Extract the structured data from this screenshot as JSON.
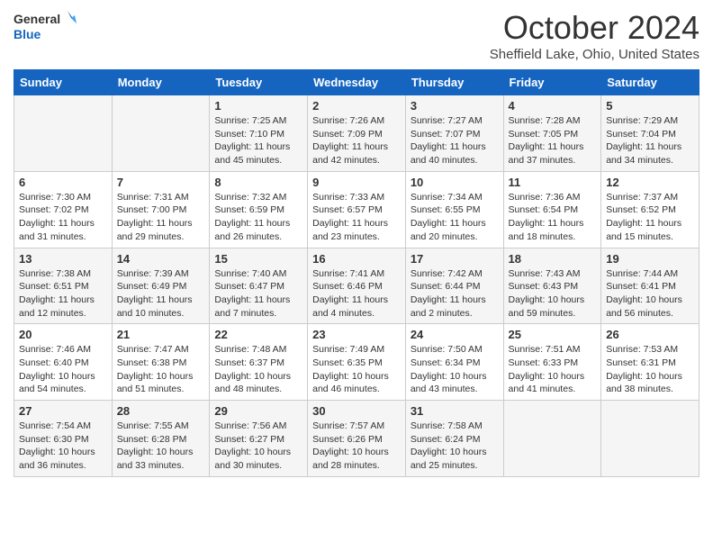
{
  "logo": {
    "line1": "General",
    "line2": "Blue"
  },
  "title": "October 2024",
  "location": "Sheffield Lake, Ohio, United States",
  "days_of_week": [
    "Sunday",
    "Monday",
    "Tuesday",
    "Wednesday",
    "Thursday",
    "Friday",
    "Saturday"
  ],
  "weeks": [
    [
      {
        "day": "",
        "info": ""
      },
      {
        "day": "",
        "info": ""
      },
      {
        "day": "1",
        "info": "Sunrise: 7:25 AM\nSunset: 7:10 PM\nDaylight: 11 hours and 45 minutes."
      },
      {
        "day": "2",
        "info": "Sunrise: 7:26 AM\nSunset: 7:09 PM\nDaylight: 11 hours and 42 minutes."
      },
      {
        "day": "3",
        "info": "Sunrise: 7:27 AM\nSunset: 7:07 PM\nDaylight: 11 hours and 40 minutes."
      },
      {
        "day": "4",
        "info": "Sunrise: 7:28 AM\nSunset: 7:05 PM\nDaylight: 11 hours and 37 minutes."
      },
      {
        "day": "5",
        "info": "Sunrise: 7:29 AM\nSunset: 7:04 PM\nDaylight: 11 hours and 34 minutes."
      }
    ],
    [
      {
        "day": "6",
        "info": "Sunrise: 7:30 AM\nSunset: 7:02 PM\nDaylight: 11 hours and 31 minutes."
      },
      {
        "day": "7",
        "info": "Sunrise: 7:31 AM\nSunset: 7:00 PM\nDaylight: 11 hours and 29 minutes."
      },
      {
        "day": "8",
        "info": "Sunrise: 7:32 AM\nSunset: 6:59 PM\nDaylight: 11 hours and 26 minutes."
      },
      {
        "day": "9",
        "info": "Sunrise: 7:33 AM\nSunset: 6:57 PM\nDaylight: 11 hours and 23 minutes."
      },
      {
        "day": "10",
        "info": "Sunrise: 7:34 AM\nSunset: 6:55 PM\nDaylight: 11 hours and 20 minutes."
      },
      {
        "day": "11",
        "info": "Sunrise: 7:36 AM\nSunset: 6:54 PM\nDaylight: 11 hours and 18 minutes."
      },
      {
        "day": "12",
        "info": "Sunrise: 7:37 AM\nSunset: 6:52 PM\nDaylight: 11 hours and 15 minutes."
      }
    ],
    [
      {
        "day": "13",
        "info": "Sunrise: 7:38 AM\nSunset: 6:51 PM\nDaylight: 11 hours and 12 minutes."
      },
      {
        "day": "14",
        "info": "Sunrise: 7:39 AM\nSunset: 6:49 PM\nDaylight: 11 hours and 10 minutes."
      },
      {
        "day": "15",
        "info": "Sunrise: 7:40 AM\nSunset: 6:47 PM\nDaylight: 11 hours and 7 minutes."
      },
      {
        "day": "16",
        "info": "Sunrise: 7:41 AM\nSunset: 6:46 PM\nDaylight: 11 hours and 4 minutes."
      },
      {
        "day": "17",
        "info": "Sunrise: 7:42 AM\nSunset: 6:44 PM\nDaylight: 11 hours and 2 minutes."
      },
      {
        "day": "18",
        "info": "Sunrise: 7:43 AM\nSunset: 6:43 PM\nDaylight: 10 hours and 59 minutes."
      },
      {
        "day": "19",
        "info": "Sunrise: 7:44 AM\nSunset: 6:41 PM\nDaylight: 10 hours and 56 minutes."
      }
    ],
    [
      {
        "day": "20",
        "info": "Sunrise: 7:46 AM\nSunset: 6:40 PM\nDaylight: 10 hours and 54 minutes."
      },
      {
        "day": "21",
        "info": "Sunrise: 7:47 AM\nSunset: 6:38 PM\nDaylight: 10 hours and 51 minutes."
      },
      {
        "day": "22",
        "info": "Sunrise: 7:48 AM\nSunset: 6:37 PM\nDaylight: 10 hours and 48 minutes."
      },
      {
        "day": "23",
        "info": "Sunrise: 7:49 AM\nSunset: 6:35 PM\nDaylight: 10 hours and 46 minutes."
      },
      {
        "day": "24",
        "info": "Sunrise: 7:50 AM\nSunset: 6:34 PM\nDaylight: 10 hours and 43 minutes."
      },
      {
        "day": "25",
        "info": "Sunrise: 7:51 AM\nSunset: 6:33 PM\nDaylight: 10 hours and 41 minutes."
      },
      {
        "day": "26",
        "info": "Sunrise: 7:53 AM\nSunset: 6:31 PM\nDaylight: 10 hours and 38 minutes."
      }
    ],
    [
      {
        "day": "27",
        "info": "Sunrise: 7:54 AM\nSunset: 6:30 PM\nDaylight: 10 hours and 36 minutes."
      },
      {
        "day": "28",
        "info": "Sunrise: 7:55 AM\nSunset: 6:28 PM\nDaylight: 10 hours and 33 minutes."
      },
      {
        "day": "29",
        "info": "Sunrise: 7:56 AM\nSunset: 6:27 PM\nDaylight: 10 hours and 30 minutes."
      },
      {
        "day": "30",
        "info": "Sunrise: 7:57 AM\nSunset: 6:26 PM\nDaylight: 10 hours and 28 minutes."
      },
      {
        "day": "31",
        "info": "Sunrise: 7:58 AM\nSunset: 6:24 PM\nDaylight: 10 hours and 25 minutes."
      },
      {
        "day": "",
        "info": ""
      },
      {
        "day": "",
        "info": ""
      }
    ]
  ]
}
